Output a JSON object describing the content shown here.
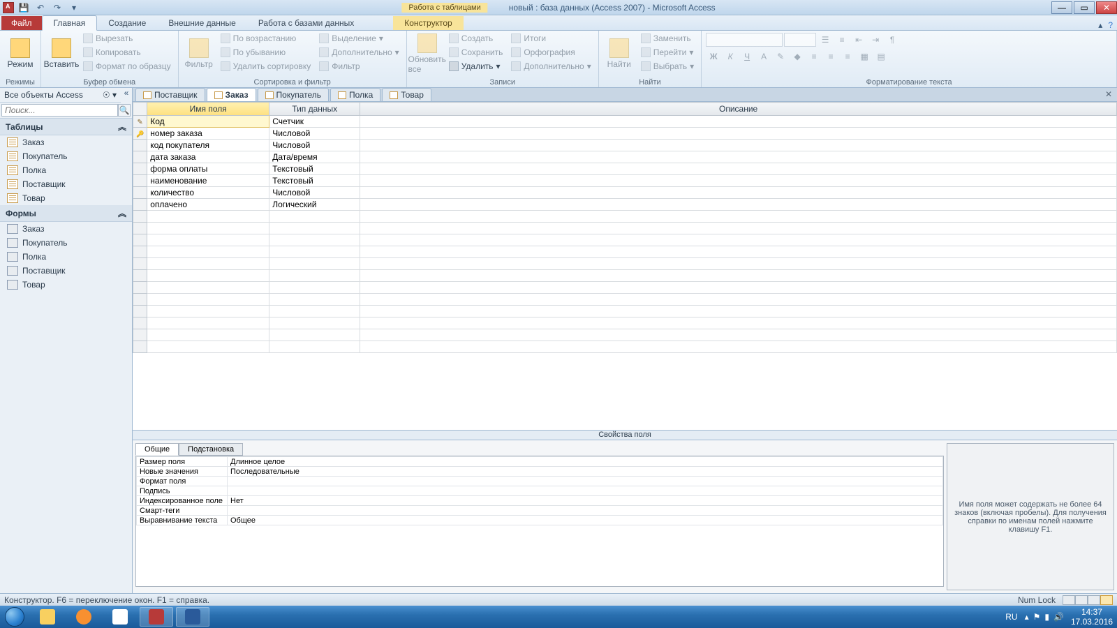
{
  "title": {
    "context": "Работа с таблицами",
    "doc": "новый : база данных (Access 2007)  -  Microsoft Access"
  },
  "ribbon": {
    "file": "Файл",
    "tabs": [
      "Главная",
      "Создание",
      "Внешние данные",
      "Работа с базами данных"
    ],
    "contextTab": "Конструктор",
    "groups": {
      "views": {
        "label": "Режимы",
        "btn": "Режим"
      },
      "clipboard": {
        "label": "Буфер обмена",
        "paste": "Вставить",
        "cut": "Вырезать",
        "copy": "Копировать",
        "brush": "Формат по образцу"
      },
      "sortfilter": {
        "label": "Сортировка и фильтр",
        "filter": "Фильтр",
        "asc": "По возрастанию",
        "desc": "По убыванию",
        "clear": "Удалить сортировку",
        "sel": "Выделение",
        "adv": "Дополнительно",
        "tog": "Фильтр"
      },
      "records": {
        "label": "Записи",
        "refresh": "Обновить все",
        "new": "Создать",
        "save": "Сохранить",
        "delete": "Удалить",
        "totals": "Итоги",
        "spell": "Орфография",
        "more": "Дополнительно"
      },
      "find": {
        "label": "Найти",
        "find": "Найти",
        "replace": "Заменить",
        "goto": "Перейти",
        "select": "Выбрать"
      },
      "format": {
        "label": "Форматирование текста"
      }
    }
  },
  "nav": {
    "header": "Все объекты Access",
    "search_ph": "Поиск...",
    "groups": [
      {
        "name": "Таблицы",
        "items": [
          "Заказ",
          "Покупатель",
          "Полка",
          "Поставщик",
          "Товар"
        ],
        "icon": "table"
      },
      {
        "name": "Формы",
        "items": [
          "Заказ",
          "Покупатель",
          "Полка",
          "Поставщик",
          "Товар"
        ],
        "icon": "form"
      }
    ]
  },
  "tabs": [
    {
      "name": "Поставщик",
      "active": false
    },
    {
      "name": "Заказ",
      "active": true
    },
    {
      "name": "Покупатель",
      "active": false
    },
    {
      "name": "Полка",
      "active": false
    },
    {
      "name": "Товар",
      "active": false
    }
  ],
  "design": {
    "cols": {
      "name": "Имя поля",
      "type": "Тип данных",
      "desc": "Описание"
    },
    "rows": [
      {
        "name": "Код",
        "type": "Счетчик",
        "edit": true
      },
      {
        "name": "номер заказа",
        "type": "Числовой",
        "pk": true
      },
      {
        "name": "код покупателя",
        "type": "Числовой"
      },
      {
        "name": "дата заказа",
        "type": "Дата/время"
      },
      {
        "name": "форма оплаты",
        "type": "Текстовый"
      },
      {
        "name": "наименование",
        "type": "Текстовый"
      },
      {
        "name": "количество",
        "type": "Числовой"
      },
      {
        "name": "оплачено",
        "type": "Логический"
      }
    ],
    "blank_rows": 12
  },
  "props": {
    "sep": "Свойства поля",
    "tabs": [
      "Общие",
      "Подстановка"
    ],
    "rows": [
      {
        "n": "Размер поля",
        "v": "Длинное целое"
      },
      {
        "n": "Новые значения",
        "v": "Последовательные"
      },
      {
        "n": "Формат поля",
        "v": ""
      },
      {
        "n": "Подпись",
        "v": ""
      },
      {
        "n": "Индексированное поле",
        "v": "Нет"
      },
      {
        "n": "Смарт-теги",
        "v": ""
      },
      {
        "n": "Выравнивание текста",
        "v": "Общее"
      }
    ],
    "help": "Имя поля может содержать не более 64 знаков (включая пробелы). Для получения справки по именам полей нажмите клавишу F1."
  },
  "status": {
    "left": "Конструктор.   F6 = переключение окон.   F1 = справка.",
    "numlock": "Num Lock"
  },
  "tray": {
    "lang": "RU",
    "time": "14:37",
    "date": "17.03.2016"
  }
}
